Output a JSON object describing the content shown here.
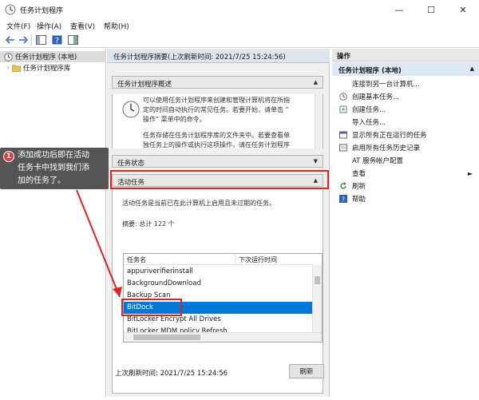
{
  "window": {
    "title": "任务计划程序"
  },
  "menu": [
    "文件(F)",
    "操作(A)",
    "查看(V)",
    "帮助(H)"
  ],
  "tree": {
    "root": "任务计划程序 (本地)",
    "child": "任务计划程序库"
  },
  "center": {
    "header": "任务计划程序摘要(上次刷新时间: 2021/7/25 15:24:56)",
    "overview_title": "任务计划程序概述",
    "overview_text_1": [
      "可以使用任务计划程序来创建和管理计算机将在所指",
      "定的时间自动执行的常见任务。若要开始，请单击 “",
      "操作” 菜单中的命令。"
    ],
    "overview_text_2": [
      "任务存储在任务计划程序库的文件夹中。若要查看单",
      "独任务上的操作或执行这项操作，请在任务计划程序"
    ],
    "status_title": "任务状态",
    "active_title": "活动任务",
    "active_desc": "活动任务是当前已在此计算机上启用且未过期的任务。",
    "summary": "摘要: 总计 122 个",
    "col_name": "任务名",
    "col_next": "下次运行时间",
    "tasks": [
      "appuriverifierinstall",
      "BackgroundDownload",
      "Backup Scan",
      "BitDock",
      "BitLocker Encrypt All Drives",
      "BitLocker MDM policy Refresh"
    ],
    "selected_task": "BitDock",
    "last_refresh": "上次刷新时间: 2021/7/25 15:24:56",
    "refresh_button": "刷新"
  },
  "actions": {
    "header": "操作",
    "sub": "任务计划程序 (本地)",
    "items": [
      "连接到另一台计算机...",
      "创建基本任务...",
      "创建任务...",
      "导入任务...",
      "显示所有正在运行的任务",
      "启用所有任务历史记录",
      "AT 服务帐户配置",
      "查看",
      "刷新",
      "帮助"
    ]
  },
  "callout": {
    "badge": "1",
    "text": [
      "添加成功后即在活动",
      "任务卡中找到我们添",
      "加的任务了。"
    ]
  },
  "colors": {
    "selection": "#0078d7",
    "highlight": "#dd2222",
    "callout_bg": "#555555"
  }
}
